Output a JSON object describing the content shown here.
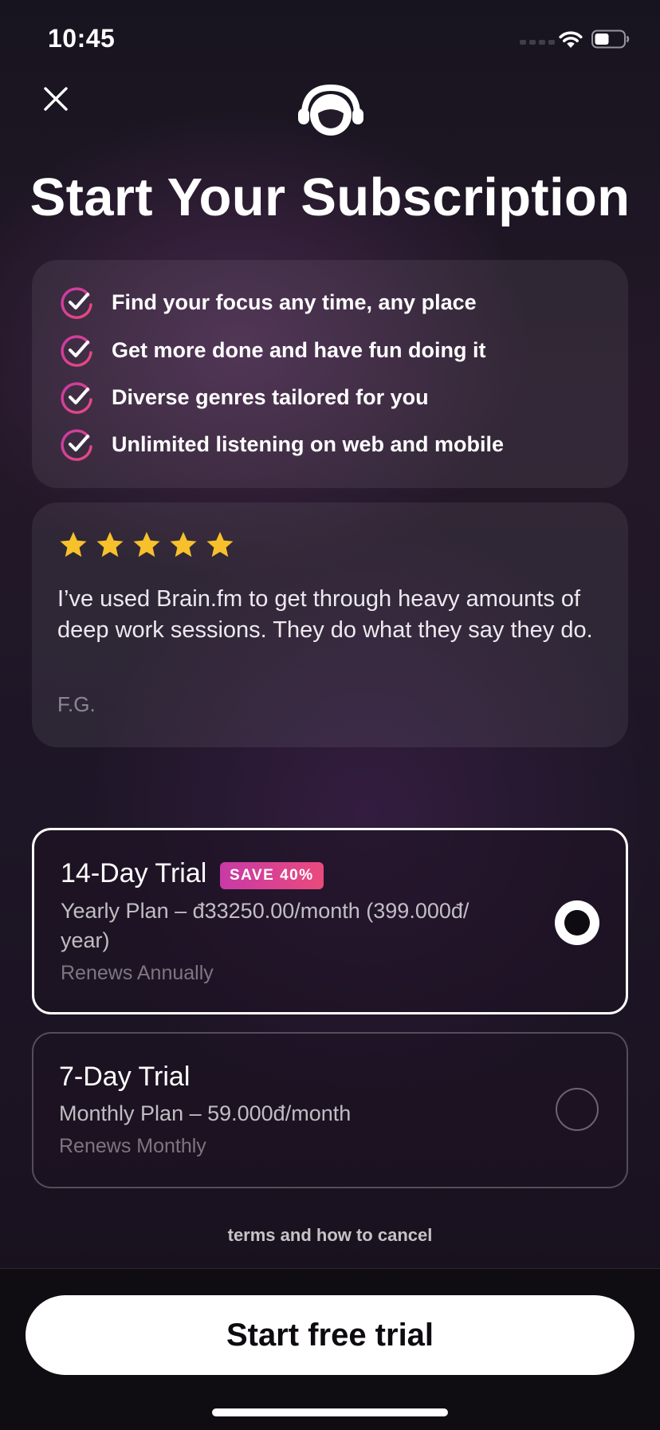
{
  "status_bar": {
    "time": "10:45"
  },
  "title": "Start Your Subscription",
  "features": [
    "Find your focus any time, any place",
    "Get more done and have fun doing it",
    "Diverse genres tailored for you",
    "Unlimited listening on web and mobile"
  ],
  "review": {
    "rating": 5,
    "text": "I’ve used Brain.fm to get through heavy amounts of deep work sessions. They do what they say they do.",
    "author": "F.G."
  },
  "plans": [
    {
      "name": "14-Day Trial",
      "badge": "SAVE 40%",
      "desc_line1": "Yearly Plan – đ33250.00/month (399.000đ/",
      "desc_line2": "year)",
      "renews": "Renews Annually",
      "selected": true
    },
    {
      "name": "7-Day Trial",
      "desc": "Monthly Plan – 59.000đ/month",
      "renews": "Renews Monthly",
      "selected": false
    }
  ],
  "terms_link": "terms and how to cancel",
  "cta_label": "Start free trial",
  "colors": {
    "accent_gradient_start": "#c83aa6",
    "accent_gradient_end": "#ea4a7c",
    "star": "#f7c12b",
    "background": "#1d1626"
  }
}
